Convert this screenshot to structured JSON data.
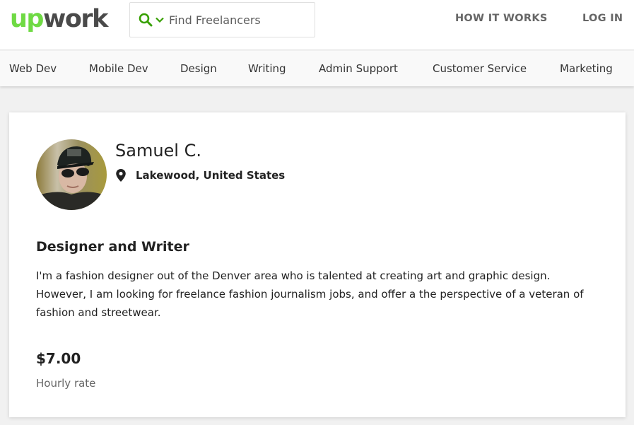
{
  "header": {
    "logo": {
      "part1": "up",
      "part2": "work"
    },
    "search": {
      "placeholder": "Find Freelancers",
      "value": "",
      "icon": "search-icon",
      "dropdown_icon": "chevron-down-icon"
    },
    "links": {
      "how_it_works": "HOW IT WORKS",
      "log_in": "LOG IN"
    },
    "colors": {
      "brand_green": "#6fda44",
      "logo_gray": "#4a4a4a",
      "search_icon_green": "#37a000"
    }
  },
  "categories": [
    {
      "label": "Web Dev"
    },
    {
      "label": "Mobile Dev"
    },
    {
      "label": "Design"
    },
    {
      "label": "Writing"
    },
    {
      "label": "Admin Support"
    },
    {
      "label": "Customer Service"
    },
    {
      "label": "Marketing"
    }
  ],
  "profile": {
    "name": "Samuel C.",
    "location": "Lakewood, United States",
    "location_icon": "map-pin-icon",
    "title": "Designer and Writer",
    "description": "I'm a fashion designer out of the Denver area who is talented at creating art and graphic design. However, I am looking for freelance fashion journalism jobs, and offer a the perspective of a veteran of fashion and streetwear.",
    "rate": "$7.00",
    "rate_label": "Hourly rate"
  }
}
